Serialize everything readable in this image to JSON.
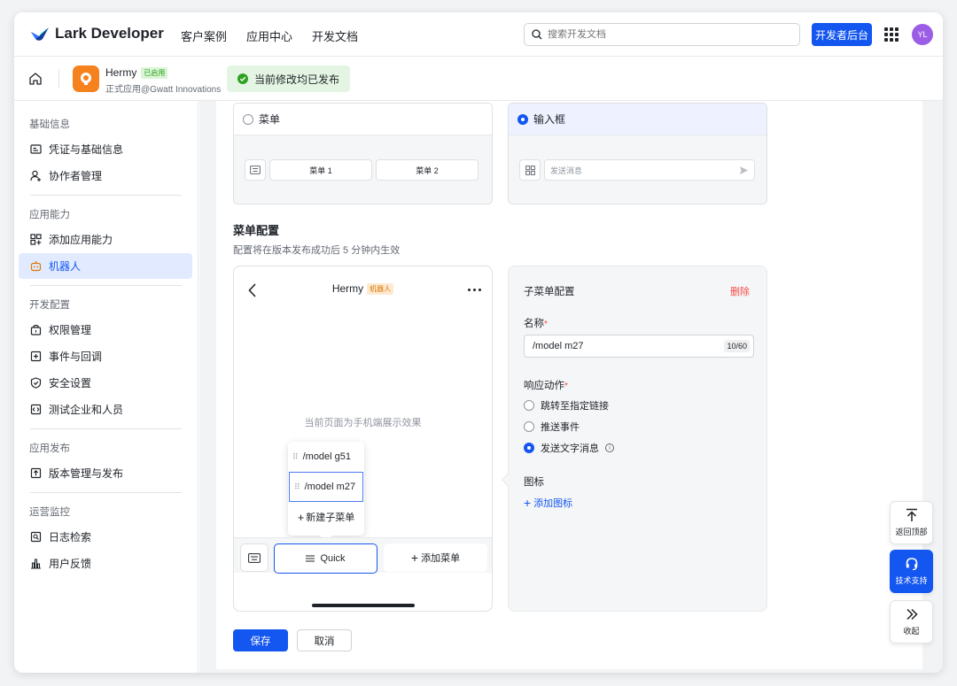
{
  "nav": {
    "brand": "Lark Developer",
    "links": [
      "客户案例",
      "应用中心",
      "开发文档"
    ],
    "search_placeholder": "搜索开发文档",
    "console_button": "开发者后台",
    "avatar_initials": "YL"
  },
  "app": {
    "name": "Hermy",
    "status_tag": "已启用",
    "subtitle": "正式应用@Gwatt Innovations",
    "publish_status": "当前修改均已发布"
  },
  "sidebar": {
    "groups": [
      {
        "title": "基础信息",
        "items": [
          {
            "label": "凭证与基础信息",
            "icon": "id-card-icon"
          },
          {
            "label": "协作者管理",
            "icon": "user-add-icon"
          }
        ]
      },
      {
        "title": "应用能力",
        "items": [
          {
            "label": "添加应用能力",
            "icon": "apps-add-icon"
          },
          {
            "label": "机器人",
            "icon": "robot-icon",
            "active": true
          }
        ]
      },
      {
        "title": "开发配置",
        "items": [
          {
            "label": "权限管理",
            "icon": "lock-box-icon"
          },
          {
            "label": "事件与回调",
            "icon": "event-icon"
          },
          {
            "label": "安全设置",
            "icon": "shield-icon"
          },
          {
            "label": "测试企业和人员",
            "icon": "code-box-icon"
          }
        ]
      },
      {
        "title": "应用发布",
        "items": [
          {
            "label": "版本管理与发布",
            "icon": "upload-box-icon"
          }
        ]
      },
      {
        "title": "运营监控",
        "items": [
          {
            "label": "日志检索",
            "icon": "log-search-icon"
          },
          {
            "label": "用户反馈",
            "icon": "bar-chart-icon"
          }
        ]
      }
    ]
  },
  "input_mode": {
    "menu_option": "菜单",
    "menu_sample_1": "菜单 1",
    "menu_sample_2": "菜单 2",
    "input_option": "输入框",
    "input_placeholder": "发送消息"
  },
  "menu_config": {
    "title": "菜单配置",
    "description": "配置将在版本发布成功后 5 分钟内生效"
  },
  "preview": {
    "bot_name": "Hermy",
    "bot_tag": "机器人",
    "center_text": "当前页面为手机端展示效果",
    "submenu_items": [
      "/model g51",
      "/model m27"
    ],
    "new_submenu": "新建子菜单",
    "quick_label": "Quick",
    "add_menu": "添加菜单"
  },
  "submenu_config": {
    "title": "子菜单配置",
    "delete": "删除",
    "name_label": "名称",
    "name_value": "/model m27",
    "name_counter": "10/60",
    "action_label": "响应动作",
    "actions": [
      "跳转至指定链接",
      "推送事件",
      "发送文字消息"
    ],
    "selected_action": 2,
    "icon_label": "图标",
    "add_icon": "添加图标"
  },
  "footer": {
    "save": "保存",
    "cancel": "取消"
  },
  "floating": {
    "back_top": "返回顶部",
    "support": "技术支持",
    "collapse": "收起"
  },
  "colors": {
    "primary": "#1456f0",
    "danger": "#f54a45",
    "success": "#2ea121",
    "app_icon": "#f5811f"
  }
}
